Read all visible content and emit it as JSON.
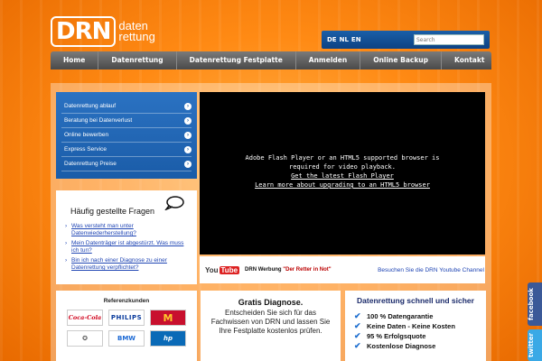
{
  "header": {
    "logo_mark": "DRN",
    "logo_line1": "daten",
    "logo_line2": "rettung",
    "languages": [
      "DE",
      "NL",
      "EN"
    ],
    "search_placeholder": "Search"
  },
  "nav": {
    "items": [
      "Home",
      "Datenrettung",
      "Datenrettung Festplatte",
      "Anmelden",
      "Online Backup",
      "Kontakt"
    ]
  },
  "side_menu": {
    "items": [
      "Datenrettung ablauf",
      "Beratung bei Datenverlust",
      "Online bewerben",
      "Express Service",
      "Datenrettung Preise"
    ]
  },
  "faq": {
    "title": "Häufig gestellte Fragen",
    "links": [
      "Was versteht man unter Datenwiederherstellung?",
      "Mein Datenträger ist abgestürzt. Was muss ich tun?",
      "Bin ich nach einer Diagnose zu einer Datenrettung verpflichtet?"
    ]
  },
  "video": {
    "message": "Adobe Flash Player or an HTML5 supported browser is required for video playback.",
    "link1": "Get the latest Flash Player",
    "link2": "Learn more about upgrading to an HTML5 browser",
    "yt_text": "You",
    "yt_tube": "Tube",
    "caption_prefix": "DRN Werbung ",
    "caption_quote": "\"Der Retter in Not\"",
    "yt_channel_link": "Besuchen Sie die DRN Youtube Channel"
  },
  "references": {
    "title": "Referenzkunden",
    "logos": [
      "Coca-Cola",
      "PHILIPS",
      "M",
      "✪",
      "BMW",
      "hp"
    ]
  },
  "diagnosis": {
    "title": "Gratis Diagnose.",
    "text": "Entscheiden Sie sich für das Fachwissen von DRN und lassen Sie Ihre Festplatte kostenlos prüfen."
  },
  "benefits": {
    "title": "Datenrettung schnell und sicher",
    "items": [
      "100 % Datengarantie",
      "Keine Daten - Keine Kosten",
      "95 % Erfolgsquote",
      "Kostenlose Diagnose"
    ]
  },
  "social": {
    "facebook": "facebook",
    "twitter": "twitter"
  }
}
